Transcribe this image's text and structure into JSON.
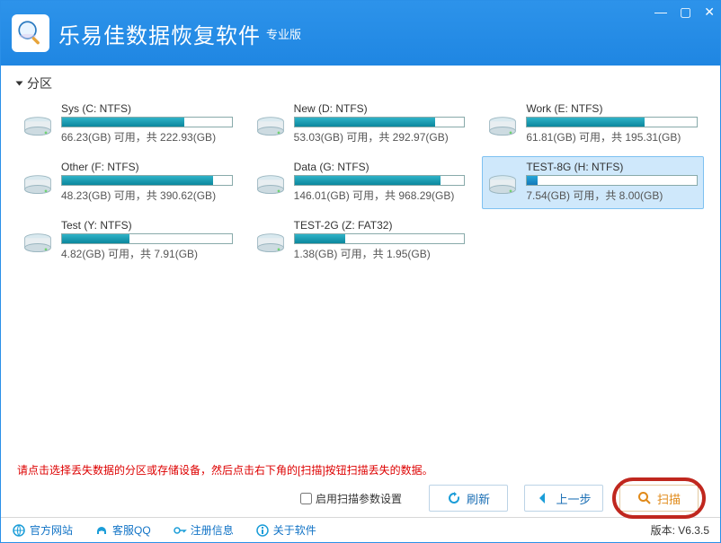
{
  "app": {
    "title": "乐易佳数据恢复软件",
    "subtitle": "专业版"
  },
  "section": {
    "label": "分区"
  },
  "partitions": [
    {
      "name": "Sys (C: NTFS)",
      "free": "66.23(GB)",
      "total": "222.93(GB)",
      "pct": 72,
      "selected": false
    },
    {
      "name": "New (D: NTFS)",
      "free": "53.03(GB)",
      "total": "292.97(GB)",
      "pct": 83,
      "selected": false
    },
    {
      "name": "Work (E: NTFS)",
      "free": "61.81(GB)",
      "total": "195.31(GB)",
      "pct": 69,
      "selected": false
    },
    {
      "name": "Other (F: NTFS)",
      "free": "48.23(GB)",
      "total": "390.62(GB)",
      "pct": 89,
      "selected": false
    },
    {
      "name": "Data (G: NTFS)",
      "free": "146.01(GB)",
      "total": "968.29(GB)",
      "pct": 86,
      "selected": false
    },
    {
      "name": "TEST-8G (H: NTFS)",
      "free": "7.54(GB)",
      "total": "8.00(GB)",
      "pct": 6,
      "selected": true
    },
    {
      "name": "Test (Y: NTFS)",
      "free": "4.82(GB)",
      "total": "7.91(GB)",
      "pct": 40,
      "selected": false
    },
    {
      "name": "TEST-2G (Z: FAT32)",
      "free": "1.38(GB)",
      "total": "1.95(GB)",
      "pct": 30,
      "selected": false
    }
  ],
  "labels": {
    "stat_free": " 可用，共 ",
    "stat_free_unitless": " 可用，共 "
  },
  "hint": "请点击选择丢失数据的分区或存储设备，然后点击右下角的[扫描]按钮扫描丢失的数据。",
  "actions": {
    "enable_opts": "启用扫描参数设置",
    "refresh": "刷新",
    "back": "上一步",
    "scan": "扫描"
  },
  "footer": {
    "site": "官方网站",
    "qq": "客服QQ",
    "reg": "注册信息",
    "about": "关于软件",
    "version_label": "版本:",
    "version": "V6.3.5"
  }
}
